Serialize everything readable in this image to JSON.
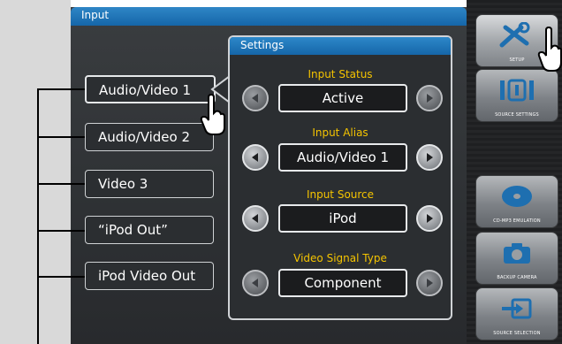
{
  "screen": {
    "title": "Input"
  },
  "settings": {
    "title": "Settings",
    "rows": [
      {
        "label": "Input Status",
        "value": "Active"
      },
      {
        "label": "Input Alias",
        "value": "Audio/Video 1"
      },
      {
        "label": "Input Source",
        "value": "iPod"
      },
      {
        "label": "Video Signal Type",
        "value": "Component"
      }
    ]
  },
  "sources": [
    {
      "label": "Audio/Video 1",
      "selected": true
    },
    {
      "label": "Audio/Video 2",
      "selected": false
    },
    {
      "label": "Video 3",
      "selected": false
    },
    {
      "label": "“iPod Out”",
      "selected": false
    },
    {
      "label": "iPod Video Out",
      "selected": false
    }
  ],
  "side_buttons": [
    {
      "caption": "SETUP",
      "icon": "tools-icon"
    },
    {
      "caption": "SOURCE SETTINGS",
      "icon": "source-settings-icon"
    },
    {
      "caption": "CD-MP3 EMULATION",
      "icon": "disc-icon"
    },
    {
      "caption": "BACKUP CAMERA",
      "icon": "camera-icon"
    },
    {
      "caption": "SOURCE SELECTION",
      "icon": "source-selection-icon"
    }
  ],
  "colors": {
    "header_blue": "#1a72b5",
    "label_yellow": "#f5c400",
    "panel_dark": "#2b2e31"
  }
}
